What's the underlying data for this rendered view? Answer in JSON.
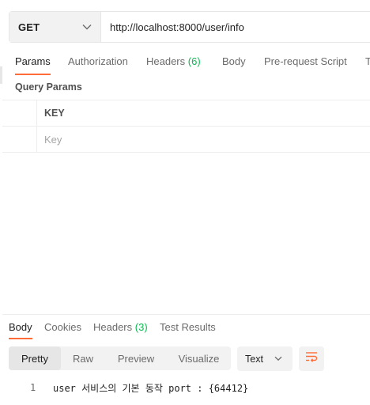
{
  "request": {
    "method": "GET",
    "url": "http://localhost:8000/user/info"
  },
  "request_tabs": [
    {
      "label": "Params",
      "active": true
    },
    {
      "label": "Authorization"
    },
    {
      "label": "Headers",
      "badge": "(6)"
    },
    {
      "label": "Body"
    },
    {
      "label": "Pre-request Script"
    },
    {
      "label": "T"
    }
  ],
  "query_params": {
    "title": "Query Params",
    "key_header": "KEY",
    "key_placeholder": "Key"
  },
  "response_tabs": [
    {
      "label": "Body",
      "active": true
    },
    {
      "label": "Cookies"
    },
    {
      "label": "Headers",
      "badge": "(3)"
    },
    {
      "label": "Test Results"
    }
  ],
  "view_modes": [
    "Pretty",
    "Raw",
    "Preview",
    "Visualize"
  ],
  "format": "Text",
  "response_body": {
    "line_number": "1",
    "text": "user 서비스의 기본 동작 port : {64412}"
  },
  "colors": {
    "accent": "#ff6c37",
    "badge": "#0cbb52"
  },
  "icons": {
    "method_dropdown": "chevron-down-icon",
    "format_dropdown": "chevron-down-icon",
    "wrap": "wrap-lines-icon"
  }
}
